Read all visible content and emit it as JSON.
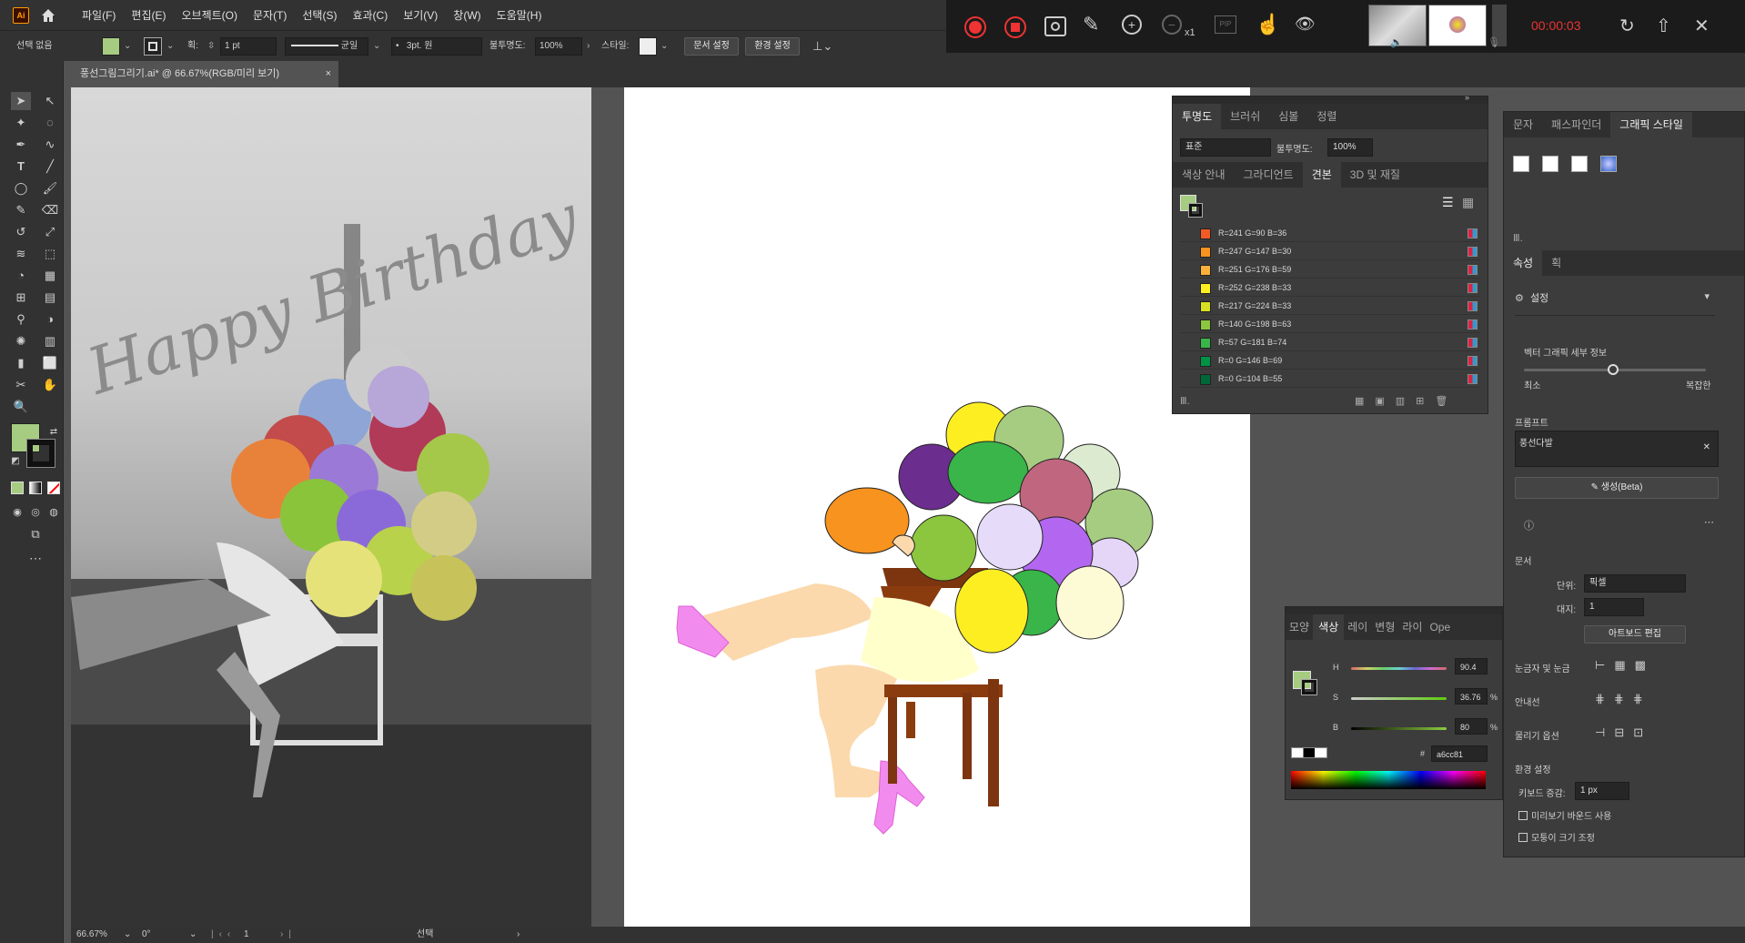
{
  "app": {
    "logo": "Ai"
  },
  "menu": [
    "파일(F)",
    "편집(E)",
    "오브젝트(O)",
    "문자(T)",
    "선택(S)",
    "효과(C)",
    "보기(V)",
    "창(W)",
    "도움말(H)"
  ],
  "control": {
    "selection": "선택 없음",
    "stroke_label": "획:",
    "stroke_value": "1 pt",
    "profile_label": "균일",
    "brush_value": "3pt. 원",
    "opacity_label": "불투명도:",
    "opacity_value": "100%",
    "style_label": "스타일:",
    "doc_setup": "문서 설정",
    "prefs": "환경 설정"
  },
  "recorder": {
    "timer": "00:00:03",
    "zoom": "x1",
    "pip": "PIP"
  },
  "document": {
    "tab_title": "풍선그림그리기.ai* @ 66.67%(RGB/미리 보기)",
    "close": "×"
  },
  "photo": {
    "text": "Happy Birthday"
  },
  "transparency": {
    "tabs": [
      "투명도",
      "브러쉬",
      "심볼",
      "정렬"
    ],
    "mode": "표준",
    "opacity_label": "불투명도:",
    "opacity_value": "100%"
  },
  "swatches": {
    "tabs": [
      "색상 안내",
      "그라디언트",
      "견본",
      "3D 및 재질"
    ],
    "items": [
      {
        "label": "R=241 G=90 B=36",
        "color": "#f15a24"
      },
      {
        "label": "R=247 G=147 B=30",
        "color": "#f7931e"
      },
      {
        "label": "R=251 G=176 B=59",
        "color": "#fbb03b"
      },
      {
        "label": "R=252 G=238 B=33",
        "color": "#fcee21"
      },
      {
        "label": "R=217 G=224 B=33",
        "color": "#d9e021"
      },
      {
        "label": "R=140 G=198 B=63",
        "color": "#8cc63f"
      },
      {
        "label": "R=57 G=181 B=74",
        "color": "#39b54a"
      },
      {
        "label": "R=0 G=146 B=69",
        "color": "#009245"
      },
      {
        "label": "R=0 G=104 B=55",
        "color": "#006837"
      }
    ]
  },
  "color_panel": {
    "tabs": [
      "모양",
      "색상",
      "레이",
      "변형",
      "라이",
      "Ope"
    ],
    "h_label": "H",
    "h_value": "90.4",
    "s_label": "S",
    "s_value": "36.76",
    "b_label": "B",
    "b_value": "80",
    "pct": "%",
    "hex_prefix": "#",
    "hex": "a6cc81",
    "fill": "#a6cc81"
  },
  "right_panel": {
    "tabs": [
      "문자",
      "패스파인더",
      "그래픽 스타일"
    ],
    "props_tabs": [
      "속성",
      "획"
    ],
    "settings": "설정",
    "vector_detail": "벡터 그래픽 세부 정보",
    "min": "최소",
    "max": "복잡한",
    "prompt_label": "프롬프트",
    "prompt_value": "풍선다발",
    "generate": "생성(Beta)",
    "doc_header": "문서",
    "unit_label": "단위:",
    "unit_value": "픽셀",
    "artboard_label": "대지:",
    "artboard_value": "1",
    "artboard_edit": "아트보드 편집",
    "rulers": "눈금자 및 눈금",
    "guides": "안내선",
    "snap": "물리기 옵션",
    "env": "환경 설정",
    "keyboard_label": "키보드 증감:",
    "keyboard_value": "1 px",
    "preview_bounds": "미리보기 바운드 사용",
    "corner_scale": "모퉁이 크기 조정"
  },
  "status": {
    "zoom": "66.67%",
    "rotation": "0°",
    "artboard": "1",
    "tool": "선택"
  }
}
